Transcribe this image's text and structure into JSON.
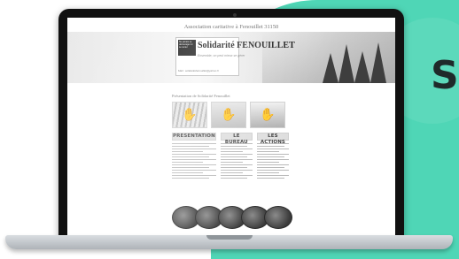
{
  "backdrop": {
    "letter": "S",
    "accent": "#4fd6b6",
    "icons": {
      "laptop": "laptop-icon"
    }
  },
  "site": {
    "title": "Association caritative à Fenouillet 31150",
    "logo": {
      "brand": "Solidarité FENOUILLET",
      "tagline": "Ensemble, on peut mieux se gérer",
      "email": "Mail : solidaritefenouillet@yahoo.fr",
      "mini_note": "Ne jamais se décourager ni se renier"
    },
    "section_title": "Présentation de Solidarité Fenouillet",
    "columns": [
      {
        "heading": "PRESENTATION"
      },
      {
        "heading": "LE BUREAU"
      },
      {
        "heading": "LES ACTIONS"
      }
    ]
  }
}
